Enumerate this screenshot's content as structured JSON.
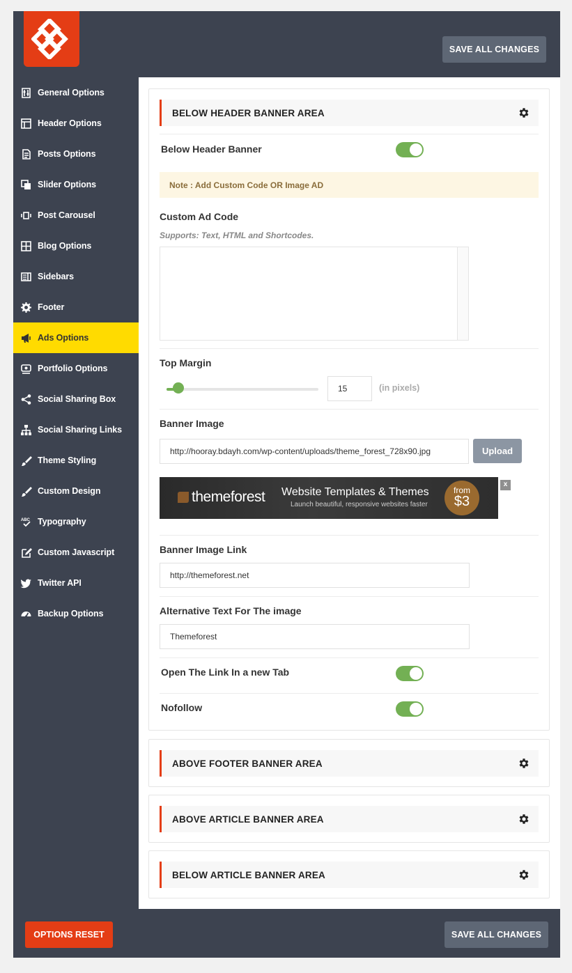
{
  "header": {
    "save_label": "SAVE ALL CHANGES"
  },
  "footer": {
    "reset_label": "OPTIONS RESET",
    "save_label": "SAVE ALL CHANGES"
  },
  "sidebar": {
    "items": [
      {
        "label": "General Options",
        "icon": "sliders-icon"
      },
      {
        "label": "Header Options",
        "icon": "header-layout-icon"
      },
      {
        "label": "Posts Options",
        "icon": "document-icon"
      },
      {
        "label": "Slider Options",
        "icon": "images-icon"
      },
      {
        "label": "Post Carousel",
        "icon": "carousel-icon"
      },
      {
        "label": "Blog Options",
        "icon": "grid-icon"
      },
      {
        "label": "Sidebars",
        "icon": "sidebar-icon"
      },
      {
        "label": "Footer",
        "icon": "gear-icon"
      },
      {
        "label": "Ads Options",
        "icon": "megaphone-icon"
      },
      {
        "label": "Portfolio Options",
        "icon": "eye-icon"
      },
      {
        "label": "Social Sharing Box",
        "icon": "share-icon"
      },
      {
        "label": "Social Sharing Links",
        "icon": "sitemap-icon"
      },
      {
        "label": "Theme Styling",
        "icon": "brush-icon"
      },
      {
        "label": "Custom Design",
        "icon": "brush-icon"
      },
      {
        "label": "Typography",
        "icon": "spellcheck-icon"
      },
      {
        "label": "Custom Javascript",
        "icon": "edit-icon"
      },
      {
        "label": "Twitter API",
        "icon": "twitter-icon"
      },
      {
        "label": "Backup Options",
        "icon": "dashboard-icon"
      }
    ],
    "active_index": 8
  },
  "below_header": {
    "title": "BELOW HEADER BANNER AREA",
    "banner_toggle_label": "Below Header Banner",
    "banner_toggle_on": true,
    "note": "Note : Add Custom Code OR Image AD",
    "custom_code_label": "Custom Ad Code",
    "custom_code_hint": "Supports: Text, HTML and Shortcodes.",
    "custom_code_value": "",
    "top_margin_label": "Top Margin",
    "top_margin_value": "15",
    "top_margin_fraction": 0.08,
    "top_margin_unit": "(in pixels)",
    "banner_image_label": "Banner Image",
    "banner_image_url": "http://hooray.bdayh.com/wp-content/uploads/theme_forest_728x90.jpg",
    "upload_label": "Upload",
    "preview": {
      "logo_text": "themeforest",
      "headline": "Website Templates & Themes",
      "subline": "Launch beautiful, responsive websites faster",
      "price_from": "from",
      "price_amount": "$3",
      "close_label": "x"
    },
    "banner_link_label": "Banner Image Link",
    "banner_link_value": "http://themeforest.net",
    "alt_text_label": "Alternative Text For The image",
    "alt_text_value": "Themeforest",
    "new_tab_label": "Open The Link In a new Tab",
    "new_tab_on": true,
    "nofollow_label": "Nofollow",
    "nofollow_on": true
  },
  "collapsed_panels": [
    {
      "title": "ABOVE FOOTER BANNER AREA"
    },
    {
      "title": "ABOVE ARTICLE BANNER AREA"
    },
    {
      "title": "BELOW ARTICLE BANNER AREA"
    }
  ],
  "colors": {
    "accent": "#e43d15",
    "active_nav": "#ffdb00",
    "toggle_on": "#73b054",
    "frame": "#3d4350"
  }
}
